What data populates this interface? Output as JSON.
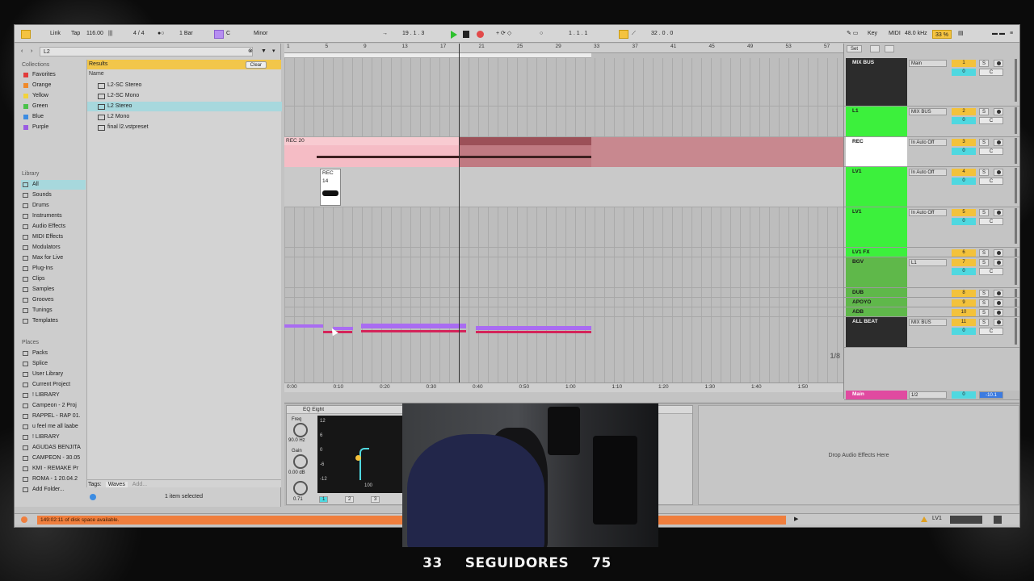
{
  "transport": {
    "link": "Link",
    "tap": "Tap",
    "tempo": "116.00",
    "time_signature": "4 / 4",
    "quantize": "1 Bar",
    "key": "C",
    "scale": "Minor",
    "position": "19 .  1 .  3",
    "loop_start": "1 .  1 .  1",
    "loop_length": "32 .  0 .  0",
    "key_label": "Key",
    "midi_label": "MIDI",
    "sample_rate": "48.0 kHz",
    "cpu": "33 %"
  },
  "browser": {
    "search_value": "L2",
    "collections_title": "Collections",
    "collections": [
      {
        "label": "Favorites",
        "color": "#e23b3b"
      },
      {
        "label": "Orange",
        "color": "#f08a2a"
      },
      {
        "label": "Yellow",
        "color": "#f2d33c"
      },
      {
        "label": "Green",
        "color": "#4ac24a"
      },
      {
        "label": "Blue",
        "color": "#3c8ce2"
      },
      {
        "label": "Purple",
        "color": "#9a5ce2"
      }
    ],
    "library_title": "Library",
    "library": [
      "All",
      "Sounds",
      "Drums",
      "Instruments",
      "Audio Effects",
      "MIDI Effects",
      "Modulators",
      "Max for Live",
      "Plug-Ins",
      "Clips",
      "Samples",
      "Grooves",
      "Tunings",
      "Templates"
    ],
    "places_title": "Places",
    "places": [
      "Packs",
      "Splice",
      "User Library",
      "Current Project",
      "! LIBRARY",
      "Campeon - 2 Proj",
      "RAPPEL - RAP 01.",
      "u feel me all laabe",
      "! LIBRARY",
      "AGUDAS BENJITA",
      "CAMPEON - 30.05",
      "KMI - REMAKE Pr",
      "ROMA - 1 20.04.2",
      "Add Folder..."
    ],
    "results_label": "Results",
    "clear_label": "Clear",
    "name_col": "Name",
    "results": [
      "L2-SC Stereo",
      "L2-SC Mono",
      "L2 Stereo",
      "L2 Mono",
      "final l2.vstpreset"
    ],
    "tags_label": "Tags:",
    "tag": "Waves",
    "add_label": "Add...",
    "status": "1 item selected"
  },
  "arrangement": {
    "bar_ticks": [
      "1",
      "5",
      "9",
      "13",
      "17",
      "21",
      "25",
      "29",
      "33",
      "37",
      "41",
      "45",
      "49",
      "53",
      "57"
    ],
    "time_ticks": [
      "0:00",
      "0:10",
      "0:20",
      "0:30",
      "0:40",
      "0:50",
      "1:00",
      "1:10",
      "1:20",
      "1:30",
      "1:40",
      "1:50"
    ],
    "clip_rec20": "REC 20",
    "clip_rec14": "REC 14",
    "zoom": "1/8"
  },
  "mixer": {
    "set_label": "Set",
    "tracks": [
      {
        "name": "MIX BUS",
        "route": "Main",
        "num": "1",
        "vol": "0",
        "pan": "C",
        "color": "#2c2c2c",
        "text": "#eeeeee"
      },
      {
        "name": "L1",
        "route": "MIX BUS",
        "num": "2",
        "vol": "0",
        "pan": "C",
        "color": "#3cf03c",
        "text": "#1a1a1a"
      },
      {
        "name": "REC",
        "route": "In  Auto  Off",
        "num": "3",
        "vol": "0",
        "pan": "C",
        "color": "#ffffff",
        "text": "#1a1a1a"
      },
      {
        "name": "LV1",
        "route": "In  Auto  Off",
        "num": "4",
        "vol": "0",
        "pan": "C",
        "color": "#3cf03c",
        "text": "#1a1a1a"
      },
      {
        "name": "LV1",
        "route": "In  Auto  Off",
        "num": "5",
        "vol": "0",
        "pan": "C",
        "color": "#3cf03c",
        "text": "#1a1a1a"
      },
      {
        "name": "LV1 FX",
        "route": "",
        "num": "6",
        "vol": "",
        "pan": "",
        "color": "#3cf03c",
        "text": "#1a1a1a"
      },
      {
        "name": "BGV",
        "route": "L1",
        "num": "7",
        "vol": "0",
        "pan": "C",
        "color": "#5fb84a",
        "text": "#1a1a1a"
      },
      {
        "name": "DUB",
        "route": "",
        "num": "8",
        "vol": "",
        "pan": "",
        "color": "#5fb84a",
        "text": "#1a1a1a"
      },
      {
        "name": "APOYO",
        "route": "",
        "num": "9",
        "vol": "",
        "pan": "",
        "color": "#5fb84a",
        "text": "#1a1a1a"
      },
      {
        "name": "ADB",
        "route": "",
        "num": "10",
        "vol": "",
        "pan": "",
        "color": "#5fb84a",
        "text": "#1a1a1a"
      },
      {
        "name": "ALL BEAT",
        "route": "MIX BUS",
        "num": "11",
        "vol": "0",
        "pan": "C",
        "color": "#2c2c2c",
        "text": "#eeeeee"
      }
    ],
    "main_label": "Main",
    "main_route": "1/2",
    "main_vol": "0",
    "main_db": "-10.1"
  },
  "device": {
    "eq_title": "EQ Eight",
    "freq_label": "Freq",
    "freq_value": "90.0 Hz",
    "gain_label": "Gain",
    "gain_value": "0.00 dB",
    "q_value": "0.71",
    "db_ticks": [
      "12",
      "6",
      "0",
      "-6",
      "-12"
    ],
    "axis_100": "100",
    "band_nums": [
      "1",
      "2",
      "3"
    ],
    "drop_text": "Drop Audio Effects Here"
  },
  "status_bar": {
    "disk": "149:02:11 of disk space available.",
    "track_label": "LV1"
  },
  "overlay": {
    "count_left": "33",
    "caption": "SEGUIDORES",
    "count_right": "75"
  }
}
